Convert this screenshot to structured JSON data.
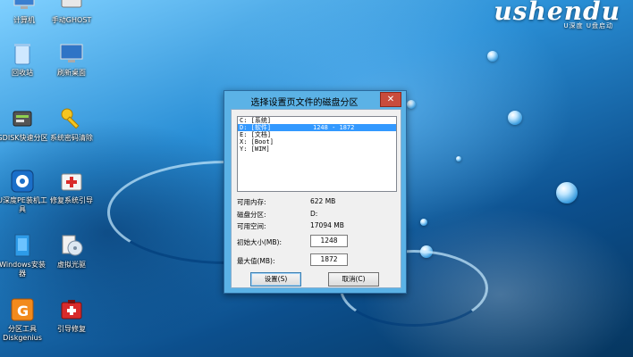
{
  "brand": {
    "logo_text": "ushendu",
    "tagline": "U深度 U盘启动"
  },
  "desktop_icons": [
    {
      "label": "计算机",
      "icon": "computer-icon"
    },
    {
      "label": "手动GHOST",
      "icon": "ghost-icon"
    },
    {
      "label": "回收站",
      "icon": "recycle-bin-icon"
    },
    {
      "label": "刷新桌面",
      "icon": "refresh-desktop-icon"
    },
    {
      "label": "GDISK快速分区",
      "icon": "partition-tool-icon"
    },
    {
      "label": "系统密码清除",
      "icon": "key-icon"
    },
    {
      "label": "U深度PE装机工具",
      "icon": "installer-icon"
    },
    {
      "label": "修复系统引导",
      "icon": "first-aid-icon"
    },
    {
      "label": "Windows安装器",
      "icon": "windows-installer-icon"
    },
    {
      "label": "虚拟光驱",
      "icon": "virtual-drive-icon"
    },
    {
      "label": "分区工具Diskgenius",
      "icon": "diskgenius-icon"
    },
    {
      "label": "引导修复",
      "icon": "boot-repair-icon"
    }
  ],
  "dialog": {
    "title": "选择设置页文件的磁盘分区",
    "close_label": "✕",
    "drives": [
      {
        "drive": "C: [系统]",
        "range": ""
      },
      {
        "drive": "D: [软件]",
        "range": "1248 - 1872",
        "selected": true
      },
      {
        "drive": "E: [文档]",
        "range": ""
      },
      {
        "drive": "X: [Boot]",
        "range": ""
      },
      {
        "drive": "Y: [WIM]",
        "range": ""
      }
    ],
    "info": {
      "available_memory_label": "可用内存:",
      "available_memory_value": "622 MB",
      "partition_label": "磁盘分区:",
      "partition_value": "D:",
      "free_space_label": "可用空间:",
      "free_space_value": "17094 MB",
      "initial_size_label": "初始大小(MB):",
      "initial_size_value": "1248",
      "max_size_label": "最大值(MB):",
      "max_size_value": "1872"
    },
    "set_button": "设置(S)",
    "cancel_button": "取消(C)"
  }
}
